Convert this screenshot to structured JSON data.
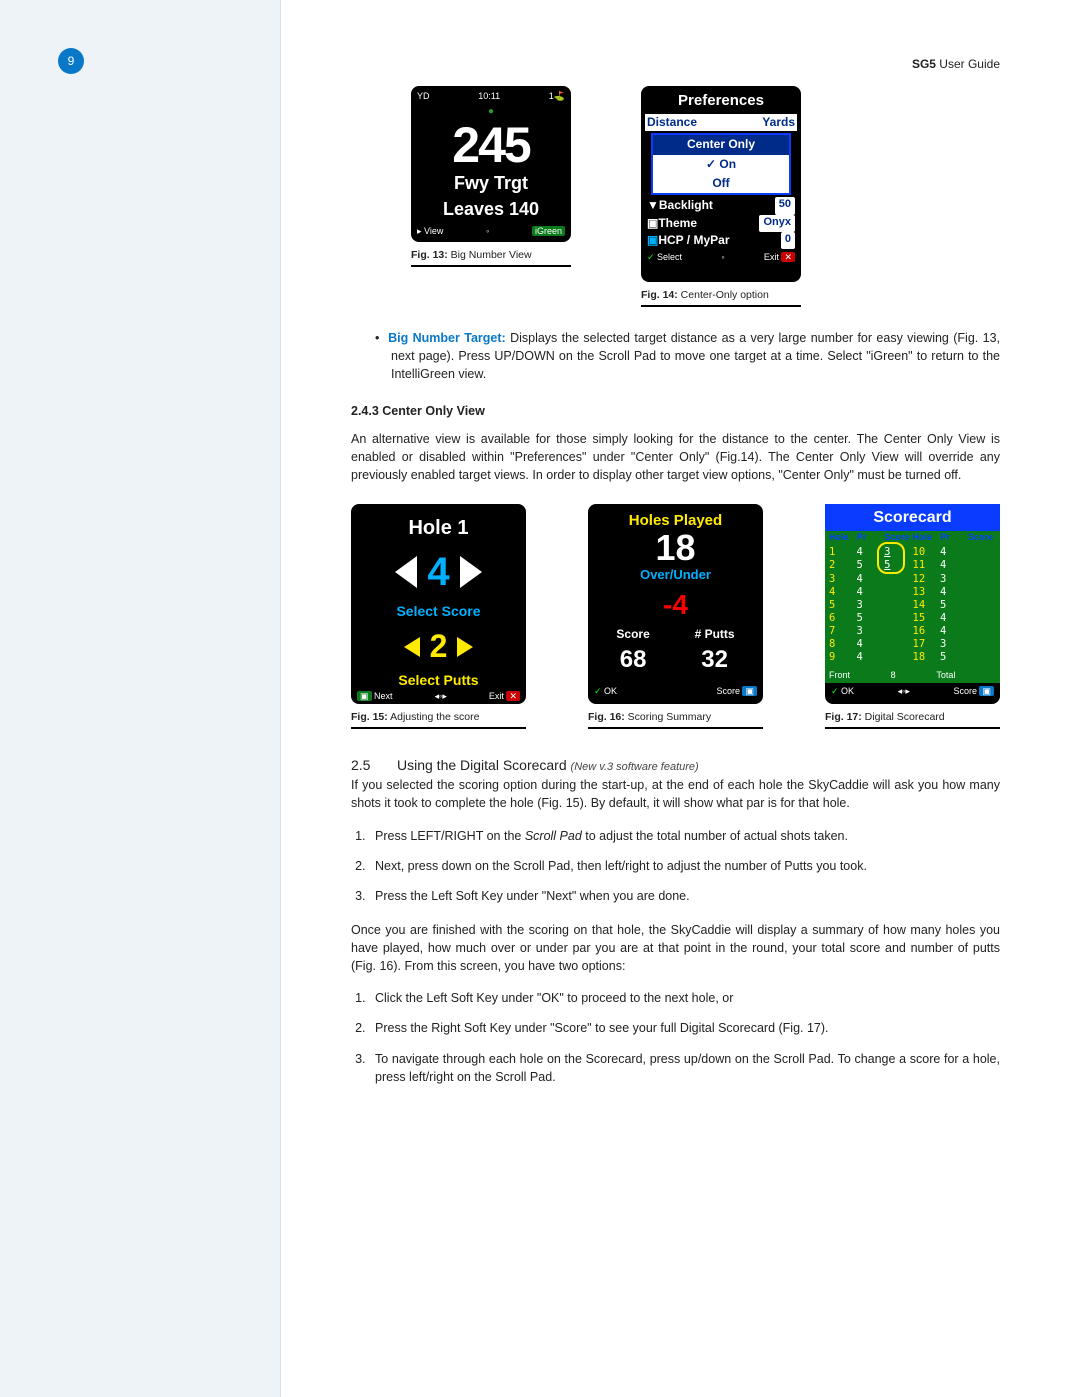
{
  "page_number": "9",
  "header": {
    "bold": "SG5 ",
    "rest": "User Guide"
  },
  "fig13": {
    "status_left": "YD",
    "status_time": "10:11",
    "status_right": "1⛳",
    "big_number": "245",
    "line1": "Fwy Trgt",
    "line2": "Leaves 140",
    "sk_left": "▸ View",
    "sk_mid": "◦",
    "sk_right": "iGreen",
    "caption_b": "Fig. 13:",
    "caption_t": " Big Number View"
  },
  "fig14": {
    "title": "Preferences",
    "row_distance_l": "Distance",
    "row_distance_v": "Yards",
    "popup_title": "Center Only",
    "popup_on": "✓ On",
    "popup_off": "Off",
    "row_backlight_l": "Backlight",
    "row_backlight_v": "50",
    "row_theme_l": "Theme",
    "row_theme_v": "Onyx",
    "row_hcp_l": "HCP / MyPar",
    "row_hcp_v": "0",
    "sk_l": "✓ Select",
    "sk_m": "◦",
    "sk_r": "Exit ✕",
    "caption_b": "Fig. 14:",
    "caption_t": " Center-Only option"
  },
  "bullet_big_number": {
    "dot": "•",
    "lead": "Big Number Target:",
    "text": " Displays the selected target distance as a very large number for easy viewing (Fig. 13, next page). Press UP/DOWN on the Scroll Pad to move one target at a time. Select \"iGreen\" to return to the IntelliGreen view."
  },
  "sec243_heading": "2.4.3 Center Only View",
  "sec243_body": "An alternative view is available for those simply looking for the distance to the center. The Center Only View is enabled or disabled within \"Preferences\" under \"Center Only\" (Fig.14). The Center Only View will override any previously enabled target views. In order to display other target view options, \"Center Only\" must be turned off.",
  "fig15": {
    "hole": "Hole 1",
    "score_num": "4",
    "lbl_score": "Select Score",
    "putts_num": "2",
    "lbl_putts": "Select Putts",
    "sk_l": "▣ Next",
    "sk_m": "◂◦▸",
    "sk_r": "Exit ✕",
    "caption_b": "Fig. 15:",
    "caption_t": " Adjusting the score"
  },
  "fig16": {
    "t1": "Holes Played",
    "v1": "18",
    "t2": "Over/Under",
    "v2": "-4",
    "lbl_score": "Score",
    "v_score": "68",
    "lbl_putts": "# Putts",
    "v_putts": "32",
    "sk_l": "✓ OK",
    "sk_r": "Score ▣",
    "caption_b": "Fig. 16:",
    "caption_t": " Scoring Summary"
  },
  "fig17": {
    "title": "Scorecard",
    "hdr": [
      "Hole",
      "Pr",
      "Score",
      "Hole",
      "Pr",
      "Score"
    ],
    "left": [
      [
        "1",
        "4",
        "3"
      ],
      [
        "2",
        "5",
        "5"
      ],
      [
        "3",
        "4",
        ""
      ],
      [
        "4",
        "4",
        ""
      ],
      [
        "5",
        "3",
        ""
      ],
      [
        "6",
        "5",
        ""
      ],
      [
        "7",
        "3",
        ""
      ],
      [
        "8",
        "4",
        ""
      ],
      [
        "9",
        "4",
        ""
      ]
    ],
    "right": [
      [
        "10",
        "4",
        ""
      ],
      [
        "11",
        "4",
        ""
      ],
      [
        "12",
        "3",
        ""
      ],
      [
        "13",
        "4",
        ""
      ],
      [
        "14",
        "5",
        ""
      ],
      [
        "15",
        "4",
        ""
      ],
      [
        "16",
        "4",
        ""
      ],
      [
        "17",
        "3",
        ""
      ],
      [
        "18",
        "5",
        ""
      ]
    ],
    "front_lbl": "Front",
    "front_v": "8",
    "total_lbl": "Total",
    "total_v": "",
    "sk_l": "✓ OK",
    "sk_m": "◂◦▸",
    "sk_r": "Score ▣",
    "caption_b": "Fig. 17:",
    "caption_t": " Digital Scorecard"
  },
  "sec25": {
    "num": "2.5",
    "title": "Using the Digital Scorecard",
    "note": "(New v.3 software feature)"
  },
  "sec25_intro": "If you selected the scoring option during the start-up, at the end of each hole the SkyCaddie will ask you how many shots it took to complete the hole (Fig. 15). By default, it will show what par is for that hole.",
  "steps_a": [
    {
      "pre": "Press LEFT/RIGHT on the ",
      "ital": "Scroll Pad",
      "post": " to adjust the total number of actual shots taken."
    },
    {
      "pre": "Next, press down on the Scroll Pad, then left/right to adjust the number of Putts you took.",
      "ital": "",
      "post": ""
    },
    {
      "pre": "Press the Left Soft Key under \"Next\" when you are done.",
      "ital": "",
      "post": ""
    }
  ],
  "sec25_mid": "Once you are finished with the scoring on that hole, the SkyCaddie will display a summary of how many holes you have played, how much over or under par you are at that point in the round, your total score and number of putts (Fig. 16). From this screen, you have two options:",
  "steps_b": [
    "Click the Left Soft Key under \"OK\" to proceed to the next hole, or",
    "Press the Right Soft Key under \"Score\" to see your full Digital Scorecard (Fig. 17).",
    "To navigate through each hole on the Scorecard, press up/down on the Scroll Pad. To change a score for a hole, press left/right on the Scroll Pad."
  ]
}
